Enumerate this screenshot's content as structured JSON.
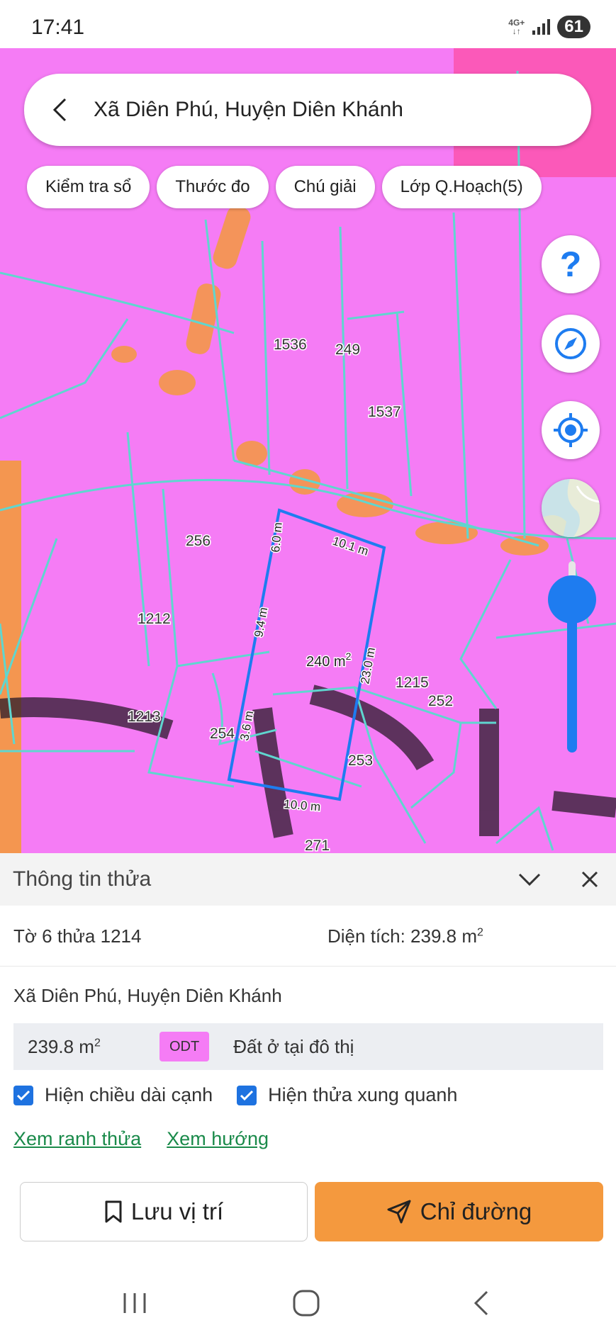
{
  "status_bar": {
    "time": "17:41",
    "network": "4G+",
    "battery": "61"
  },
  "search": {
    "title": "Xã Diên Phú, Huyện Diên Khánh"
  },
  "chips": [
    {
      "label": "Kiểm tra sổ"
    },
    {
      "label": "Thước đo"
    },
    {
      "label": "Chú giải"
    },
    {
      "label": "Lớp Q.Hoạch(5)"
    }
  ],
  "map": {
    "parcel_labels": [
      "1536",
      "249",
      "1537",
      "256",
      "1212",
      "1215",
      "252",
      "1213",
      "254",
      "253",
      "271"
    ],
    "edge_labels": [
      "6.0 m",
      "10.1 m",
      "9.4 m",
      "23.0 m",
      "3.6 m",
      "10.0 m"
    ],
    "area_label": "240 m",
    "area_sup": "2",
    "zoom_level": 0.75,
    "colors": {
      "land": "#f57cf5",
      "boundary": "#5fd6cf",
      "selected": "#1e7cf0",
      "road": "#f4993e"
    }
  },
  "controls": {
    "help_icon": "question-mark-icon",
    "compass_icon": "compass-icon",
    "location_icon": "crosshair-icon",
    "layer_icon": "map-thumbnail-icon"
  },
  "info": {
    "title": "Thông tin thửa",
    "parcel_id": "Tờ 6 thửa 1214",
    "area_label": "Diện tích: 239.8 m",
    "area_sup": "2",
    "address": "Xã Diên Phú, Huyện Diên Khánh",
    "land_area": "239.8 m",
    "land_area_sup": "2",
    "land_code": "ODT",
    "land_type": "Đất ở tại đô thị",
    "checkbox_edges": "Hiện chiều dài cạnh",
    "checkbox_neighbors": "Hiện thửa xung quanh",
    "link_boundary": "Xem ranh thửa",
    "link_direction": "Xem hướng",
    "save_label": "Lưu vị trí",
    "route_label": "Chỉ đường"
  }
}
